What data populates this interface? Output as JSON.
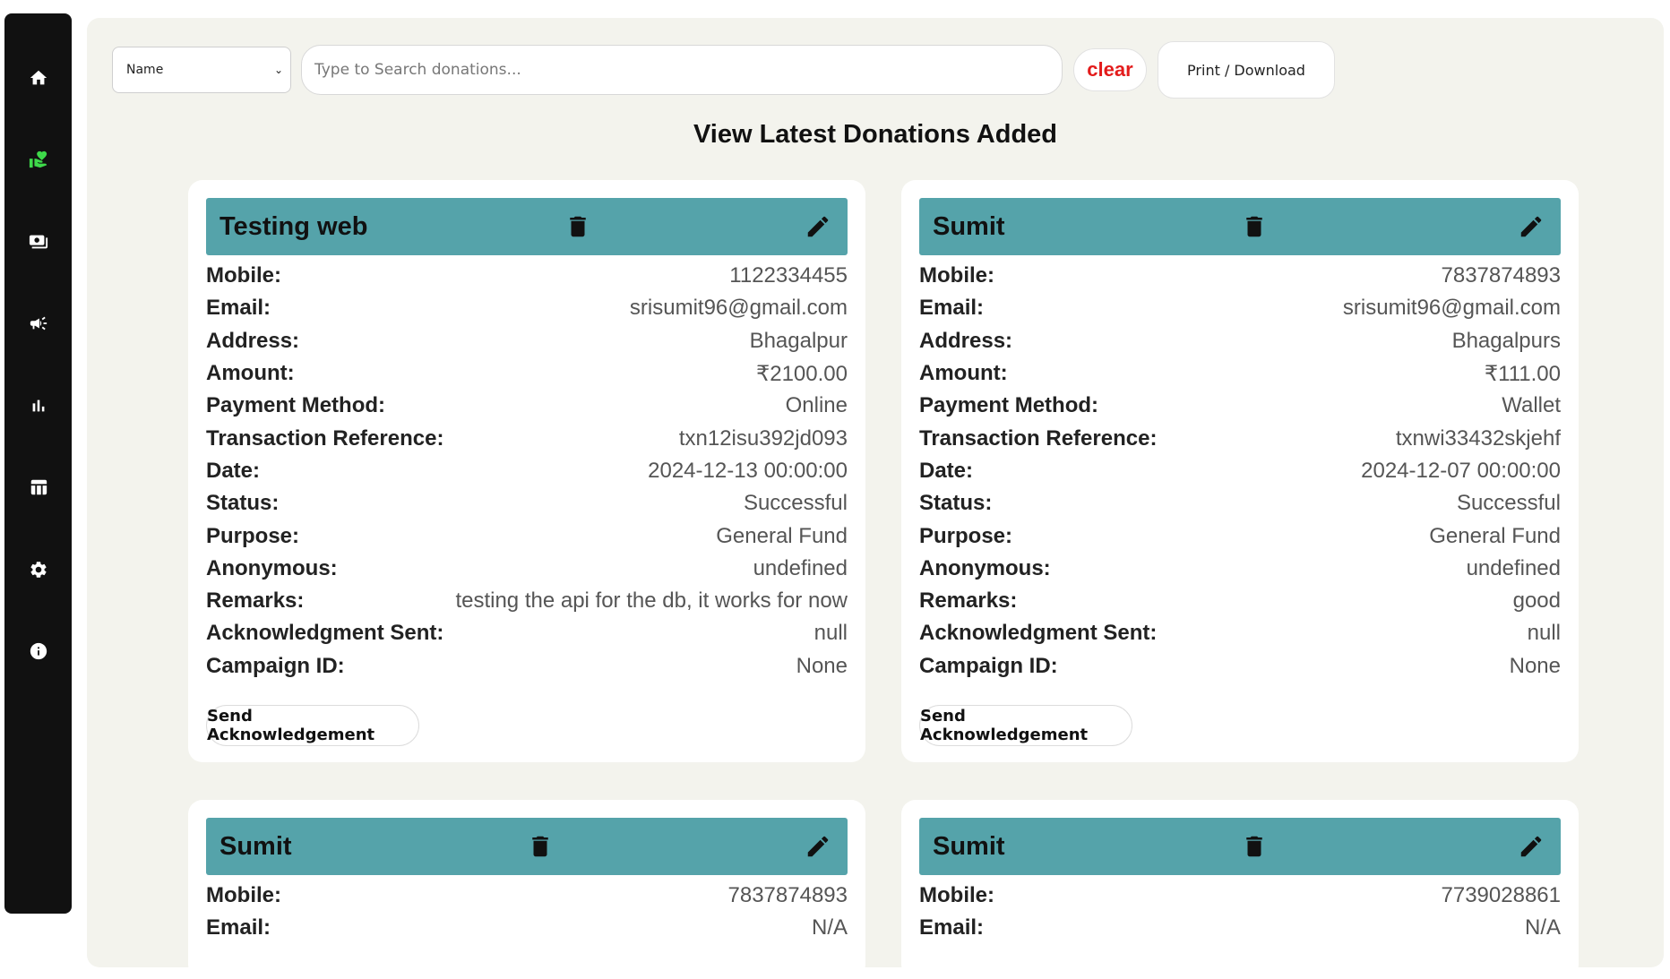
{
  "sidebar": {
    "items": [
      {
        "icon": "home-icon",
        "label": "home"
      },
      {
        "icon": "donation-hand-heart-icon",
        "label": "donations",
        "active": true
      },
      {
        "icon": "payments-icon",
        "label": "payments"
      },
      {
        "icon": "campaign-megaphone-icon",
        "label": "campaigns"
      },
      {
        "icon": "bar-chart-icon",
        "label": "analytics"
      },
      {
        "icon": "table-icon",
        "label": "table"
      },
      {
        "icon": "settings-gear-icon",
        "label": "settings"
      },
      {
        "icon": "info-icon",
        "label": "info"
      }
    ],
    "active_color": "#3ed94a"
  },
  "toolbar": {
    "filter_select_value": "Name",
    "search_placeholder": "Type to Search donations...",
    "clear_label": "clear",
    "print_label": "Print / Download"
  },
  "page_title": "View Latest Donations Added",
  "header_color": "#55a3aa",
  "field_labels": {
    "mobile": "Mobile:",
    "email": "Email:",
    "address": "Address:",
    "amount": "Amount:",
    "payment_method": "Payment Method:",
    "transaction_reference": "Transaction Reference:",
    "date": "Date:",
    "status": "Status:",
    "purpose": "Purpose:",
    "anonymous": "Anonymous:",
    "remarks": "Remarks:",
    "acknowledgment_sent": "Acknowledgment Sent:",
    "campaign_id": "Campaign ID:"
  },
  "ack_button_label": "Send Acknowledgement",
  "donations": [
    {
      "name": "Testing web",
      "mobile": "1122334455",
      "email": "srisumit96@gmail.com",
      "address": "Bhagalpur",
      "amount": "₹2100.00",
      "payment_method": "Online",
      "transaction_reference": "txn12isu392jd093",
      "date": "2024-12-13 00:00:00",
      "status": "Successful",
      "purpose": "General Fund",
      "anonymous": "undefined",
      "remarks": "testing the api for the db, it works for now",
      "acknowledgment_sent": "null",
      "campaign_id": "None"
    },
    {
      "name": "Sumit",
      "mobile": "7837874893",
      "email": "srisumit96@gmail.com",
      "address": "Bhagalpurs",
      "amount": "₹111.00",
      "payment_method": "Wallet",
      "transaction_reference": "txnwi33432skjehf",
      "date": "2024-12-07 00:00:00",
      "status": "Successful",
      "purpose": "General Fund",
      "anonymous": "undefined",
      "remarks": "good",
      "acknowledgment_sent": "null",
      "campaign_id": "None"
    },
    {
      "name": "Sumit",
      "mobile": "7837874893",
      "email": "N/A"
    },
    {
      "name": "Sumit",
      "mobile": "7739028861",
      "email": "N/A"
    }
  ]
}
